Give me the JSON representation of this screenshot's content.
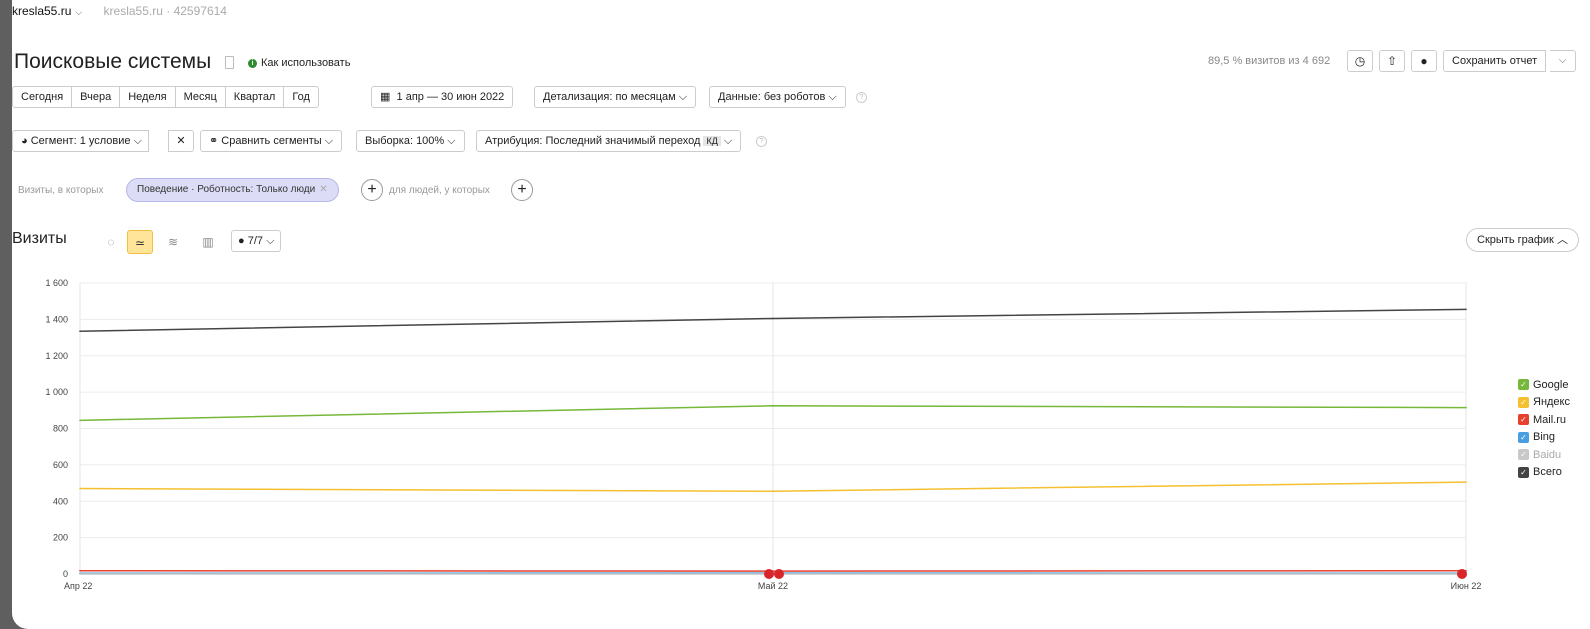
{
  "topbar": {
    "site": "kresla55.ru",
    "counter": "kresla55.ru · 42597614"
  },
  "header": {
    "title": "Поисковые системы",
    "how_to_use": "Как использовать",
    "visits_share": "89,5 % визитов из 4 692",
    "save_report": "Сохранить отчет"
  },
  "periods": [
    "Сегодня",
    "Вчера",
    "Неделя",
    "Месяц",
    "Квартал",
    "Год"
  ],
  "filters": {
    "date_range": "1 апр — 30 июн 2022",
    "detail": "Детализация: по месяцам",
    "data": "Данные: без роботов",
    "segment": "Сегмент: 1 условие",
    "compare": "Сравнить сегменты",
    "sample": "Выборка: 100%",
    "attribution": "Атрибуция: Последний значимый переход",
    "attribution_badge": "КД"
  },
  "conditions": {
    "visits_label": "Визиты, в которых",
    "chip": "Поведение · Роботность: Только люди",
    "people_label": "для людей, у которых"
  },
  "chart_panel": {
    "title": "Визиты",
    "series_count": "7/7",
    "hide_chart": "Скрыть график"
  },
  "colors": {
    "accent_yellow": "#ffe59a",
    "chip": "#dcdcf6"
  },
  "chart_data": {
    "type": "line",
    "x": [
      "Апр 22",
      "Май 22",
      "Июн 22"
    ],
    "ylim": [
      0,
      1600
    ],
    "yticks": [
      "0",
      "200",
      "400",
      "600",
      "800",
      "1 000",
      "1 200",
      "1 400",
      "1 600"
    ],
    "grid": true,
    "legend_position": "right",
    "series": [
      {
        "name": "Google",
        "color": "#76b83a",
        "values": [
          845,
          925,
          915
        ]
      },
      {
        "name": "Яндекс",
        "color": "#f5c030",
        "values": [
          470,
          455,
          505
        ]
      },
      {
        "name": "Mail.ru",
        "color": "#e8402c",
        "values": [
          18,
          16,
          18
        ]
      },
      {
        "name": "Bing",
        "color": "#4a9ee0",
        "values": [
          4,
          5,
          4
        ]
      },
      {
        "name": "Baidu",
        "color": "#c8c8c8",
        "values": [
          0,
          0,
          0
        ]
      },
      {
        "name": "Всего",
        "color": "#444444",
        "values": [
          1335,
          1405,
          1455
        ]
      }
    ]
  }
}
